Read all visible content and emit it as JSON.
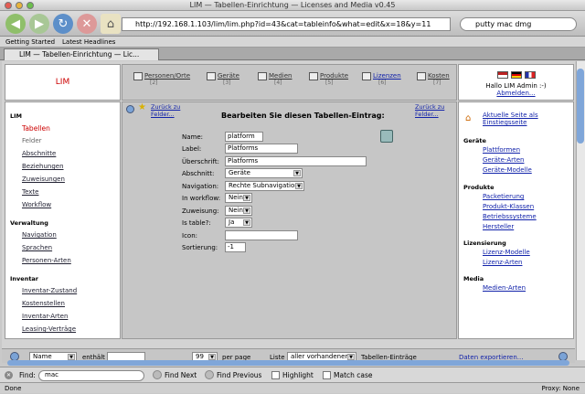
{
  "window": {
    "title": "LIM — Tabellen-Einrichtung — Licenses and Media v0.45"
  },
  "toolbar": {
    "url": "http://192.168.1.103/lim/lim.php?id=43&cat=tableinfo&what=edit&x=18&y=11",
    "search": "putty mac dmg"
  },
  "bookmarks": [
    "Getting Started",
    "Latest Headlines"
  ],
  "tab": {
    "label": "LIM — Tabellen-Einrichtung — Lic..."
  },
  "header": {
    "app_label": "LIM",
    "nav": [
      {
        "label": "Personen/Orte",
        "count": "[2]"
      },
      {
        "label": "Geräte",
        "count": "[3]"
      },
      {
        "label": "Medien",
        "count": "[4]"
      },
      {
        "label": "Produkte",
        "count": "[5]"
      },
      {
        "label": "Lizenzen",
        "count": "[6]"
      },
      {
        "label": "Kosten",
        "count": "[7]"
      }
    ],
    "user_greeting": "Hallo LIM Admin :-)",
    "logout": "Abmelden..."
  },
  "leftnav": {
    "sections": [
      {
        "title": "LIM",
        "items": [
          "Tabellen",
          "Felder",
          "Abschnitte",
          "Beziehungen",
          "Zuweisungen",
          "Texte",
          "Workflow"
        ]
      },
      {
        "title": "Verwaltung",
        "items": [
          "Navigation",
          "Sprachen",
          "Personen-Arten"
        ]
      },
      {
        "title": "Inventar",
        "items": [
          "Inventar-Zustand",
          "Kostenstellen",
          "Inventar-Arten",
          "Leasing-Verträge"
        ]
      }
    ]
  },
  "main": {
    "back_label": "Zurück zu Felder...",
    "heading": "Bearbeiten Sie diesen Tabellen-Eintrag:",
    "back_right": "Zurück zu Felder...",
    "fields": [
      {
        "label": "Name:",
        "value": "platform"
      },
      {
        "label": "Label:",
        "value": "Platforms"
      },
      {
        "label": "Überschrift:",
        "value": "Platforms"
      },
      {
        "label": "Abschnitt:",
        "value": "Geräte"
      },
      {
        "label": "Navigation:",
        "value": "Rechte Subnavigation"
      },
      {
        "label": "In workflow:",
        "value": "Nein"
      },
      {
        "label": "Zuweisung:",
        "value": "Nein"
      },
      {
        "label": "Is table?:",
        "value": "Ja"
      },
      {
        "label": "Icon:",
        "value": ""
      },
      {
        "label": "Sortierung:",
        "value": "-1"
      }
    ]
  },
  "rightnav": {
    "top_link": "Aktuelle Seite als Einstiegsseite",
    "sections": [
      {
        "title": "Geräte",
        "items": [
          "Plattformen",
          "Geräte-Arten",
          "Geräte-Modelle"
        ]
      },
      {
        "title": "Produkte",
        "items": [
          "Packetierung",
          "Produkt-Klassen",
          "Betriebssysteme",
          "Hersteller"
        ]
      },
      {
        "title": "Lizensierung",
        "items": [
          "Lizenz-Modelle",
          "Lizenz-Arten"
        ]
      },
      {
        "title": "Media",
        "items": [
          "Medien-Arten"
        ]
      }
    ]
  },
  "bottombar": {
    "field_select": "Name",
    "enthalt": "enthält",
    "per_page_value": "99",
    "per_page_label": "per page",
    "liste": "Liste",
    "liste_select": "aller vorhandenen",
    "tabellen": "Tabellen-Einträge",
    "export": "Daten exportieren..."
  },
  "findbar": {
    "label": "Find:",
    "value": "mac",
    "next": "Find Next",
    "previous": "Find Previous",
    "highlight": "Highlight",
    "match_case": "Match case"
  },
  "status": {
    "left": "Done",
    "right": "Proxy: None"
  }
}
